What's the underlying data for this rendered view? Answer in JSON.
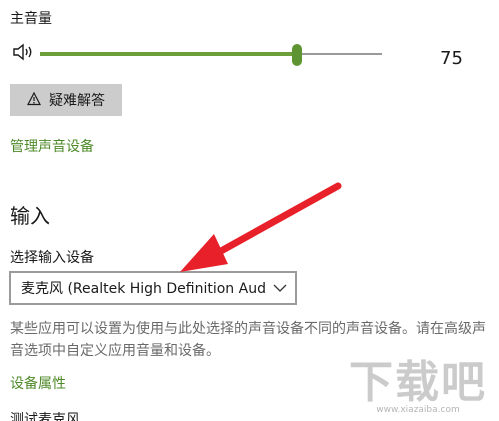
{
  "volume": {
    "label": "主音量",
    "value": 75,
    "value_text": "75",
    "accent": "#5f9433"
  },
  "troubleshoot": {
    "label": "疑难解答",
    "icon": "warning-icon"
  },
  "links": {
    "manage_devices": "管理声音设备",
    "device_properties": "设备属性"
  },
  "input": {
    "title": "输入",
    "choose_label": "选择输入设备",
    "selected_device": "麦克风 (Realtek High Definition Audi...",
    "description": "某些应用可以设置为使用与此处选择的声音设备不同的声音设备。请在高级声音选项中自定义应用音量和设备。",
    "cut_text": "测试麦克风"
  },
  "annotation": {
    "color": "#e8202a"
  },
  "watermark": {
    "logo": "下载吧",
    "url": "www.xiazaiba.com"
  }
}
